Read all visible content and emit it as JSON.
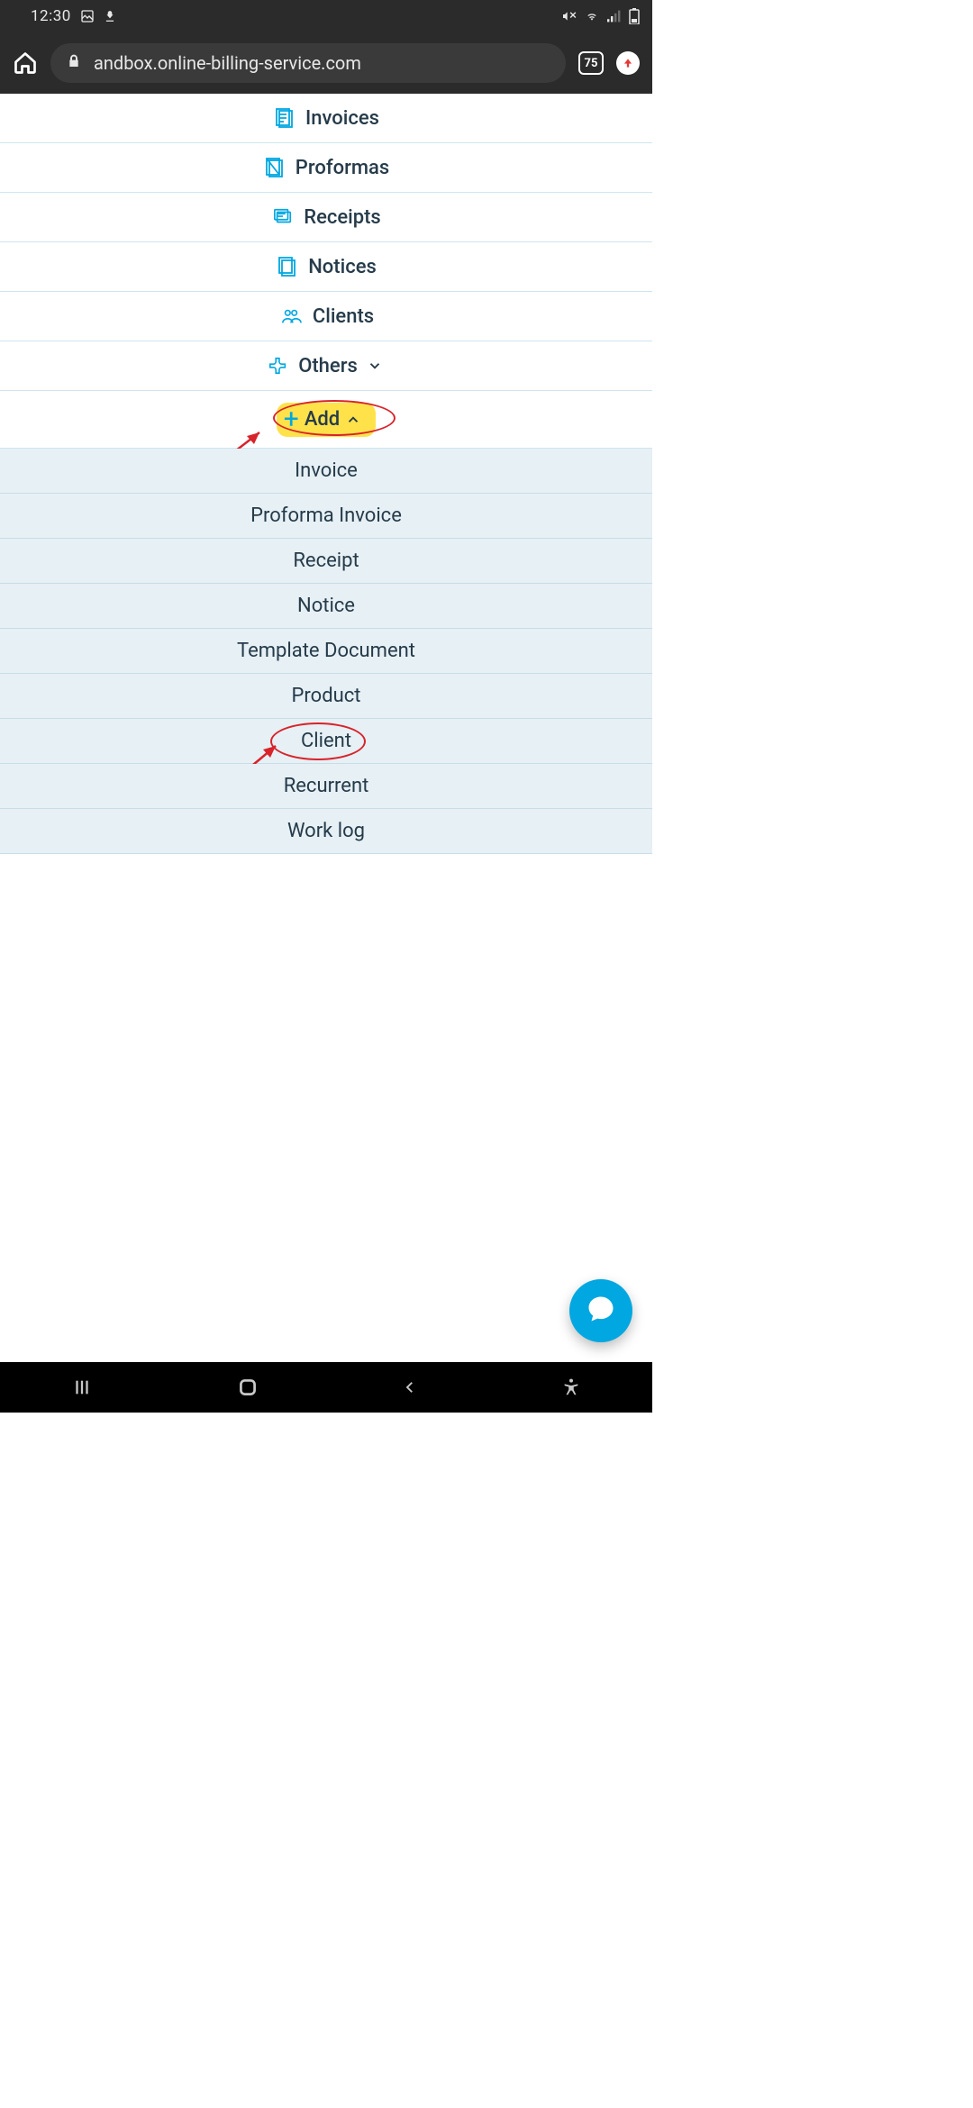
{
  "status": {
    "time": "12:30"
  },
  "browser": {
    "url": "andbox.online-billing-service.com",
    "tab_count": "75"
  },
  "nav": {
    "items": [
      {
        "label": "Invoices"
      },
      {
        "label": "Proformas"
      },
      {
        "label": "Receipts"
      },
      {
        "label": "Notices"
      },
      {
        "label": "Clients"
      },
      {
        "label": "Others"
      }
    ],
    "add_label": "Add"
  },
  "submenu": {
    "items": [
      {
        "label": "Invoice"
      },
      {
        "label": "Proforma Invoice"
      },
      {
        "label": "Receipt"
      },
      {
        "label": "Notice"
      },
      {
        "label": "Template Document"
      },
      {
        "label": "Product"
      },
      {
        "label": "Client"
      },
      {
        "label": "Recurrent"
      },
      {
        "label": "Work log"
      }
    ]
  }
}
